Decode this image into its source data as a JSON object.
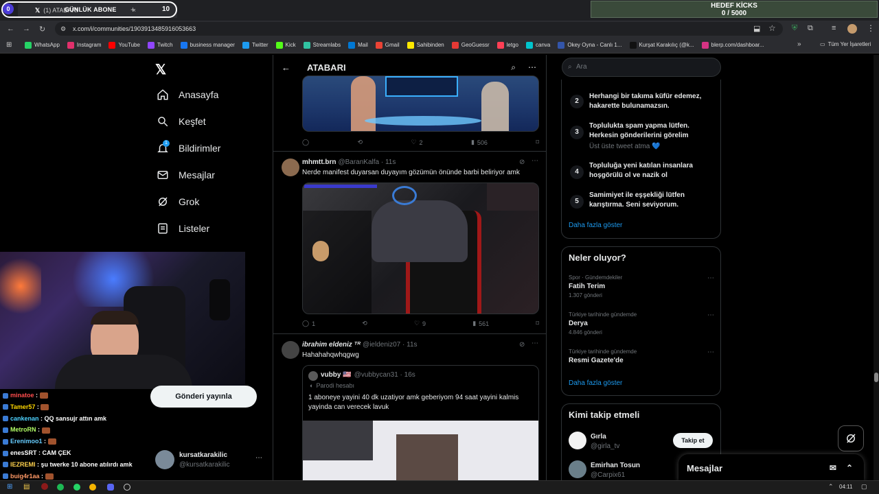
{
  "browser": {
    "tab_title": "(1) ATABARI",
    "url": "x.com/i/communities/1903913485916053663",
    "bookmarks": [
      {
        "label": "WhatsApp",
        "color": "#25d366"
      },
      {
        "label": "Instagram",
        "color": "#e1306c"
      },
      {
        "label": "YouTube",
        "color": "#ff0000"
      },
      {
        "label": "Twitch",
        "color": "#9146ff"
      },
      {
        "label": "business manager",
        "color": "#1877f2"
      },
      {
        "label": "Twitter",
        "color": "#1d9bf0"
      },
      {
        "label": "Kick",
        "color": "#53fc18"
      },
      {
        "label": "Streamlabs",
        "color": "#31c3a2"
      },
      {
        "label": "Mail",
        "color": "#0078d4"
      },
      {
        "label": "Gmail",
        "color": "#ea4335"
      },
      {
        "label": "Sahibinden",
        "color": "#ffe800"
      },
      {
        "label": "GeoGuessr",
        "color": "#e53935"
      },
      {
        "label": "letgo",
        "color": "#ff3f55"
      },
      {
        "label": "canva",
        "color": "#00c4cc"
      },
      {
        "label": "Okey Oyna - Canlı 1...",
        "color": "#3355aa"
      },
      {
        "label": "Kurşat Karakılıç (@k...",
        "color": "#111111"
      },
      {
        "label": "blerp.com/dashboar...",
        "color": "#d63384"
      }
    ],
    "all_bookmarks": "Tüm Yer İşaretleri"
  },
  "overlay": {
    "sub_count": "0",
    "daily_sub_label": "GÜNLÜK ABONE",
    "daily_sub_value": "10",
    "goal_title": "HEDEF KİCKS",
    "goal_value": "0 / 5000"
  },
  "left_nav": {
    "items": [
      {
        "label": "Anasayfa",
        "icon": "home-icon"
      },
      {
        "label": "Keşfet",
        "icon": "search-icon"
      },
      {
        "label": "Bildirimler",
        "icon": "bell-icon",
        "badge": "1"
      },
      {
        "label": "Mesajlar",
        "icon": "mail-icon"
      },
      {
        "label": "Grok",
        "icon": "grok-icon"
      },
      {
        "label": "Listeler",
        "icon": "list-icon"
      }
    ],
    "post_button": "Gönderi yayınla",
    "account_name": "kursatkarakilic",
    "account_handle": "@kursatkarakilic"
  },
  "feed": {
    "title": "ATABARI",
    "tweets": [
      {
        "actions": {
          "replies": "",
          "retweets": "",
          "likes": "2",
          "views": "506"
        }
      },
      {
        "name": "mhmtt.brn",
        "handle": "@BaranKalfa · 11s",
        "text": "Nerde manifest duyarsan duyayım gözümün önünde barbi beliriyor amk",
        "actions": {
          "replies": "1",
          "retweets": "",
          "likes": "9",
          "views": "561"
        }
      },
      {
        "name": "ibrahim eldeniz ᵀᴿ",
        "handle": "@ieldeniz07 · 11s",
        "text": "Hahahahqwhqgwg",
        "quote": {
          "name": "vubby 🇺🇸",
          "handle": "@vubbycan31 · 16s",
          "parody": "Parodi hesabı",
          "text": "1 aboneye yayini 40 dk uzatiyor amk geberiyom 94 saat yayini kalmis yayinda can verecek lavuk"
        }
      }
    ]
  },
  "sidebar": {
    "search_placeholder": "Ara",
    "rules": [
      {
        "num": "2",
        "text": "Herhangi bir takıma küfür edemez, hakarette bulunamazsın.",
        "sub": ""
      },
      {
        "num": "3",
        "text": "Toplulukta spam yapma lütfen. Herkesin gönderilerini görelim",
        "sub": "Üst üste tweet atma 💙"
      },
      {
        "num": "4",
        "text": "Topluluğa yeni katılan insanlara hoşgörülü ol ve nazik ol",
        "sub": ""
      },
      {
        "num": "5",
        "text": "Samimiyet ile eşşekliği lütfen karıştırma. Seni seviyorum.",
        "sub": ""
      }
    ],
    "show_more": "Daha fazla göster",
    "trends_title": "Neler oluyor?",
    "trends": [
      {
        "category": "Spor · Gündemdekiler",
        "name": "Fatih Terim",
        "count": "1.307 gönderi"
      },
      {
        "category": "Türkiye tarihinde gündemde",
        "name": "Derya",
        "count": "4.846 gönderi"
      },
      {
        "category": "Türkiye tarihinde gündemde",
        "name": "Resmi Gazete'de",
        "count": ""
      }
    ],
    "trends_more": "Daha fazla göster",
    "follow_title": "Kimi takip etmeli",
    "follow": [
      {
        "name": "Gırla",
        "handle": "@girla_tv",
        "button": "Takip et"
      },
      {
        "name": "Emirhan Tosun",
        "handle": "@Carpix61",
        "button": ""
      }
    ],
    "messages_label": "Mesajlar"
  },
  "chat": [
    {
      "user": "minatoe",
      "msg": "",
      "color": "#ff4d4d"
    },
    {
      "user": "Tamer57",
      "msg": "",
      "color": "#ffd700"
    },
    {
      "user": "cankenan",
      "msg": "QQ sansujr attın amk",
      "color": "#4dd2ff"
    },
    {
      "user": "MetroRN",
      "msg": "",
      "color": "#b3ff66"
    },
    {
      "user": "Erenimoo1",
      "msg": "",
      "color": "#66ccff"
    },
    {
      "user": "enesSRT",
      "msg": "CAM ÇEK",
      "color": "#ffffff"
    },
    {
      "user": "IEZREMI",
      "msg": "şu twerke 10 abone atılırdı amk",
      "color": "#ffd24d"
    },
    {
      "user": "buig4r1aa",
      "msg": "",
      "color": "#ff9966"
    }
  ],
  "taskbar": {
    "time": "04:11"
  }
}
